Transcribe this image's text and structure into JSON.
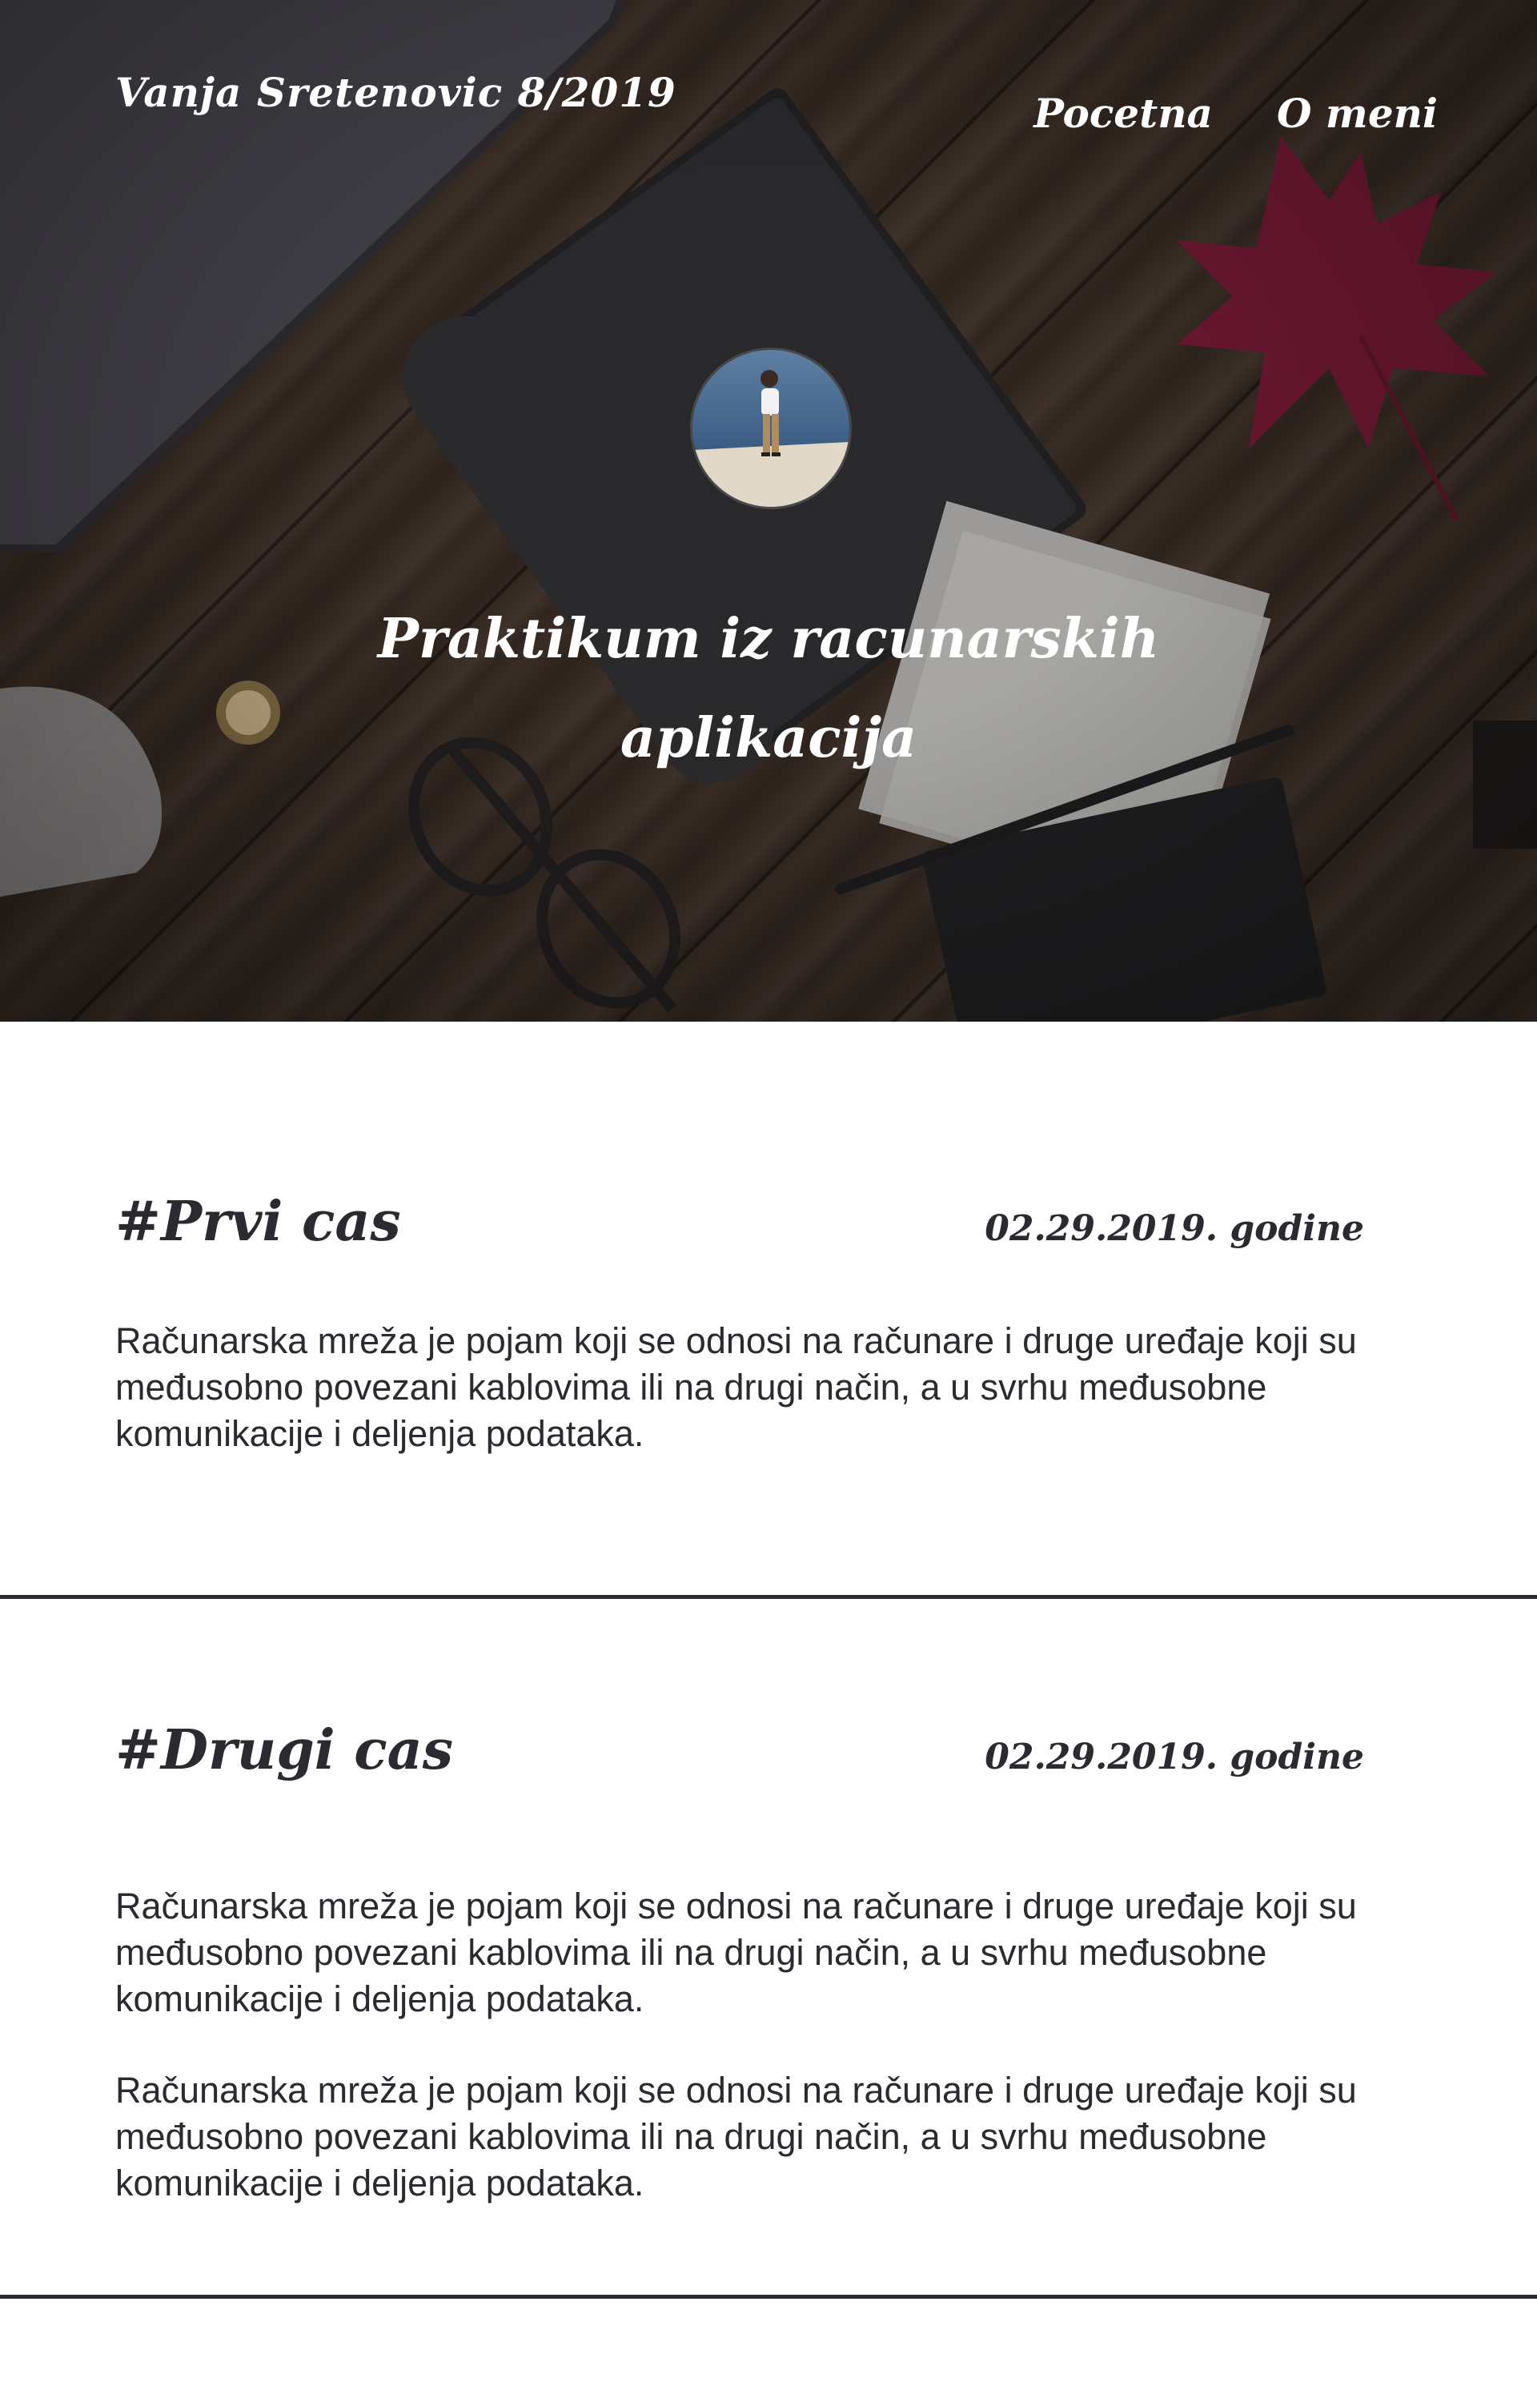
{
  "nav": {
    "brand": "Vanja Sretenovic 8/2019",
    "links": [
      {
        "label": "Pocetna"
      },
      {
        "label": "O meni"
      }
    ]
  },
  "hero": {
    "title": "Praktikum iz racunarskih aplikacija"
  },
  "posts": [
    {
      "title": "#Prvi cas",
      "date": "02.29.2019. godine",
      "paragraphs": [
        "Računarska mreža je pojam koji se odnosi na računare i druge uređaje koji su međusobno povezani kablovima ili na drugi način, a u svrhu međusobne komunikacije i deljenja podataka."
      ]
    },
    {
      "title": "#Drugi cas",
      "date": "02.29.2019. godine",
      "paragraphs": [
        "Računarska mreža je pojam koji se odnosi na računare i druge uređaje koji su međusobno povezani kablovima ili na drugi način, a u svrhu međusobne komunikacije i deljenja podataka.",
        "Računarska mreža je pojam koji se odnosi na računare i druge uređaje koji su međusobno povezani kablovima ili na drugi način, a u svrhu međusobne komunikacije i deljenja podataka."
      ]
    }
  ],
  "colors": {
    "text_dark": "#2b2a30",
    "hero_text": "#ffffff",
    "divider": "#2b2a30"
  }
}
